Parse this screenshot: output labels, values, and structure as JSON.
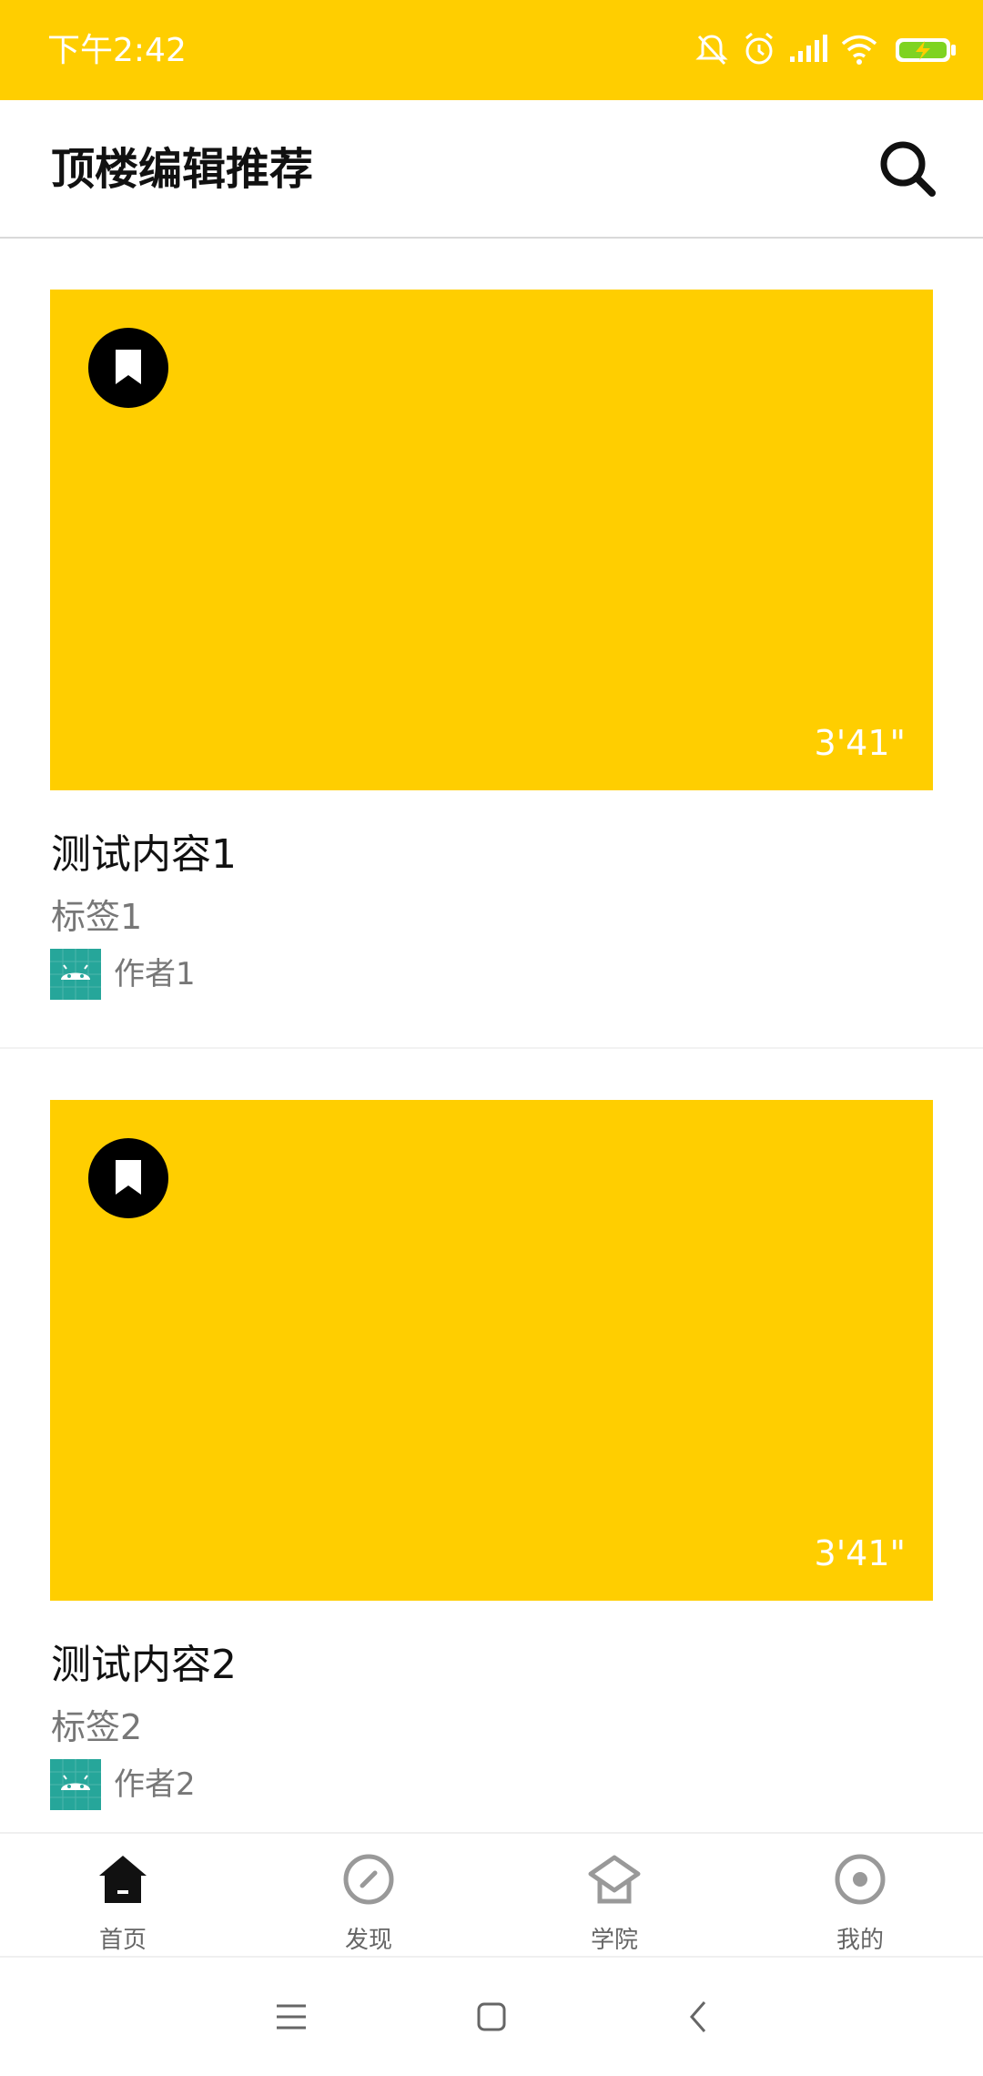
{
  "status_bar": {
    "time": "下午2:42",
    "background": "#FFCE00"
  },
  "app_bar": {
    "title": "顶楼编辑推荐",
    "search_icon": "search-icon"
  },
  "feed": {
    "items": [
      {
        "title": "测试内容1",
        "tag": "标签1",
        "author": "作者1",
        "duration": "3'41\""
      },
      {
        "title": "测试内容2",
        "tag": "标签2",
        "author": "作者2",
        "duration": "3'41\""
      }
    ]
  },
  "bottom_nav": {
    "items": [
      {
        "label": "首页",
        "icon": "home-icon",
        "active": true
      },
      {
        "label": "发现",
        "icon": "compass-icon",
        "active": false
      },
      {
        "label": "学院",
        "icon": "academy-icon",
        "active": false
      },
      {
        "label": "我的",
        "icon": "profile-icon",
        "active": false
      }
    ]
  },
  "colors": {
    "accent": "#FFCE00",
    "text_primary": "#111111",
    "text_secondary": "#777777"
  }
}
